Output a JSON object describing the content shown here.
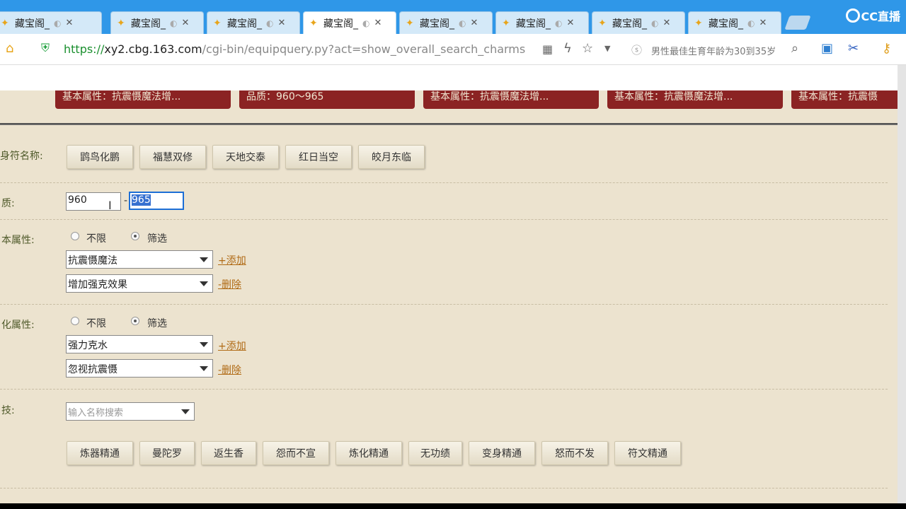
{
  "tabs": [
    {
      "label": "藏宝阁_"
    },
    {
      "label": "藏宝阁_"
    },
    {
      "label": "藏宝阁_"
    },
    {
      "label": "藏宝阁_"
    },
    {
      "label": "藏宝阁_"
    },
    {
      "label": "藏宝阁_"
    },
    {
      "label": "藏宝阁_"
    },
    {
      "label": "藏宝阁_"
    }
  ],
  "brand": {
    "label": "CC直播"
  },
  "address": {
    "scheme": "https://",
    "domain": "xy2.cbg.163.com",
    "path": "/cgi-bin/equipquery.py?act=show_overall_search_charms",
    "side_search": "男性最佳生育年龄为30到35岁"
  },
  "banners": [
    "基本属性：抗震慑魔法增...",
    "品质：960～965",
    "基本属性：抗震慑魔法增...",
    "基本属性：抗震慑魔法增...",
    "基本属性：抗震慑"
  ],
  "form": {
    "name_label": "身符名称:",
    "name_options": [
      "鹍鸟化鹏",
      "福慧双修",
      "天地交泰",
      "红日当空",
      "皎月东临"
    ],
    "quality_label": "质:",
    "quality_min": "960",
    "quality_sep": "-",
    "quality_max": "965",
    "basic_label": "本属性:",
    "basic_radio_any": "不限",
    "basic_radio_filter": "筛选",
    "basic_select_1": "抗震慑魔法",
    "basic_add": "+添加",
    "basic_select_2": "增加强克效果",
    "basic_del": "-删除",
    "ref_label": "化属性:",
    "ref_radio_any": "不限",
    "ref_radio_filter": "筛选",
    "ref_select_1": "强力克水",
    "ref_add": "+添加",
    "ref_select_2": "忽视抗震慑",
    "ref_del": "-删除",
    "skill_label": "技:",
    "skill_placeholder": "输入名称搜索",
    "skill_options": [
      "炼器精通",
      "曼陀罗",
      "返生香",
      "怨而不宣",
      "炼化精通",
      "无功绩",
      "变身精通",
      "怒而不发",
      "符文精通"
    ]
  }
}
